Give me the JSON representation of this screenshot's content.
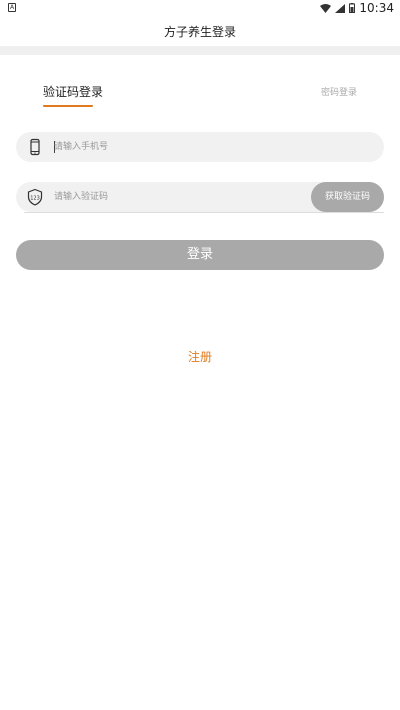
{
  "status_bar": {
    "time": "10:34",
    "left_icon": "notification-a-icon",
    "wifi_icon": "wifi-icon",
    "signal_icon": "signal-icon",
    "battery_icon": "battery-icon"
  },
  "header": {
    "title": "方子养生登录"
  },
  "tabs": {
    "code_login": "验证码登录",
    "password_login": "密码登录",
    "active": "code_login"
  },
  "form": {
    "phone_placeholder": "请输入手机号",
    "phone_value": "",
    "code_placeholder": "请输入验证码",
    "code_value": "",
    "get_code_label": "获取验证码",
    "submit_label": "登录"
  },
  "register_label": "注册",
  "colors": {
    "accent": "#e07a1f",
    "button_disabled": "#a9a9a9",
    "field_bg": "#f1f1f1"
  }
}
